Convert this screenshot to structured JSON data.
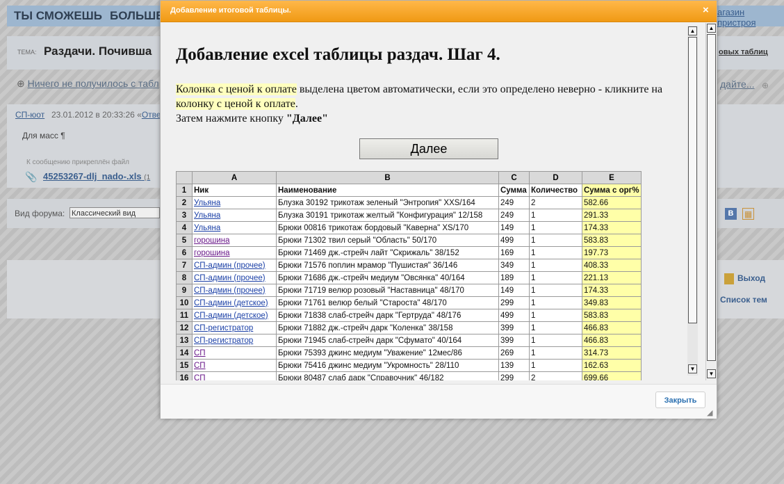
{
  "background": {
    "tabs": [
      "ТЫ СМОЖЕШЬ",
      "БОЛЬШЕ"
    ],
    "shop_link": "агазин пристроя",
    "topic_label": "ТЕМА:",
    "topic_title": "Раздачи. Почивша",
    "topic_right": "овых таблиц",
    "nav_left": "Ничего не получилось с табл",
    "nav_right": "дайте...",
    "post_author": "СП-юот",
    "post_date": "23.01.2012 в 20:33:26 «",
    "post_reply": "Отве",
    "post_text": "Для масс ¶",
    "attach_caption": "К сообщению прикреплён файл",
    "attach_file": "45253267-dlj_nado-.xls",
    "attach_size": "(1",
    "forum_view_label": "Вид форума:",
    "forum_view_value": "Классический вид",
    "exit_label": "Выход",
    "topics_list_label": "Список тем"
  },
  "modal": {
    "title": "Добавление итоговой таблицы.",
    "close_symbol": "×",
    "heading": "Добавление excel таблицы раздач. Шаг 4.",
    "instr_hl1": "Колонка с ценой к оплате",
    "instr_mid": " выделена цветом автоматически, если это определено неверно - кликните на ",
    "instr_hl2": "колонку с ценой к оплате",
    "instr_end": ".",
    "instr_line2_pre": "Затем нажмите кнопку ",
    "instr_line2_bold": "\"Далее\"",
    "next_button": "Далее",
    "footer_close": "Закрыть"
  },
  "sheet": {
    "col_headers": [
      "",
      "A",
      "B",
      "C",
      "D",
      "E"
    ],
    "row1": {
      "num": "1",
      "cells": [
        "Ник",
        "Наименование",
        "Сумма",
        "Количество",
        "Сумма с орг%"
      ]
    },
    "rows": [
      {
        "num": "2",
        "nick": "Ульяна",
        "name": "Блузка 30192 трикотаж зеленый \"Энтропия\" XXS/164",
        "sum": "249",
        "qty": "2",
        "total": "582.66"
      },
      {
        "num": "3",
        "nick": "Ульяна",
        "name": "Блузка 30191 трикотаж желтый \"Конфигурация\" 12/158",
        "sum": "249",
        "qty": "1",
        "total": "291.33"
      },
      {
        "num": "4",
        "nick": "Ульяна",
        "name": "Брюки 00816 трикотаж бордовый \"Каверна\" XS/170",
        "sum": "149",
        "qty": "1",
        "total": "174.33"
      },
      {
        "num": "5",
        "nick": "горошина",
        "name": "Брюки 71302 твил серый \"Область\" 50/170",
        "sum": "499",
        "qty": "1",
        "total": "583.83"
      },
      {
        "num": "6",
        "nick": "горошина",
        "name": "Брюки 71469 дж.-стрейч лайт \"Скрижаль\" 38/152",
        "sum": "169",
        "qty": "1",
        "total": "197.73"
      },
      {
        "num": "7",
        "nick": "СП-админ (прочее)",
        "name": "Брюки 71576 поплин мрамор \"Пушистая\" 36/146",
        "sum": "349",
        "qty": "1",
        "total": "408.33"
      },
      {
        "num": "8",
        "nick": "СП-админ (прочее)",
        "name": "Брюки 71686 дж.-стрейч медиум \"Овсянка\" 40/164",
        "sum": "189",
        "qty": "1",
        "total": "221.13"
      },
      {
        "num": "9",
        "nick": "СП-админ (прочее)",
        "name": "Брюки 71719 велюр розовый \"Наставница\" 48/170",
        "sum": "149",
        "qty": "1",
        "total": "174.33"
      },
      {
        "num": "10",
        "nick": "СП-админ (детское)",
        "name": "Брюки 71761 велюр белый \"Староста\" 48/170",
        "sum": "299",
        "qty": "1",
        "total": "349.83"
      },
      {
        "num": "11",
        "nick": "СП-админ (детское)",
        "name": "Брюки 71838 слаб-стрейч дарк \"Гертруда\" 48/176",
        "sum": "499",
        "qty": "1",
        "total": "583.83"
      },
      {
        "num": "12",
        "nick": "СП-регистратор",
        "name": "Брюки 71882 дж.-стрейч дарк \"Коленка\" 38/158",
        "sum": "399",
        "qty": "1",
        "total": "466.83"
      },
      {
        "num": "13",
        "nick": "СП-регистратор",
        "name": "Брюки 71945 слаб-стрейч дарк \"Сфумато\" 40/164",
        "sum": "399",
        "qty": "1",
        "total": "466.83"
      },
      {
        "num": "14",
        "nick": "СП",
        "name": "Брюки 75393 джинс медиум \"Уважение\" 12мес/86",
        "sum": "269",
        "qty": "1",
        "total": "314.73"
      },
      {
        "num": "15",
        "nick": "СП",
        "name": "Брюки 75416 джинс медиум \"Укромность\" 28/110",
        "sum": "139",
        "qty": "1",
        "total": "162.63"
      },
      {
        "num": "16",
        "nick": "СП",
        "name": "Брюки 80487 слаб дарк \"Справочник\" 46/182",
        "sum": "299",
        "qty": "2",
        "total": "699.66"
      }
    ]
  },
  "colors": {
    "modal_header": "#f5a623",
    "highlight_column": "#ffffa8",
    "link": "#1a3fa6"
  }
}
